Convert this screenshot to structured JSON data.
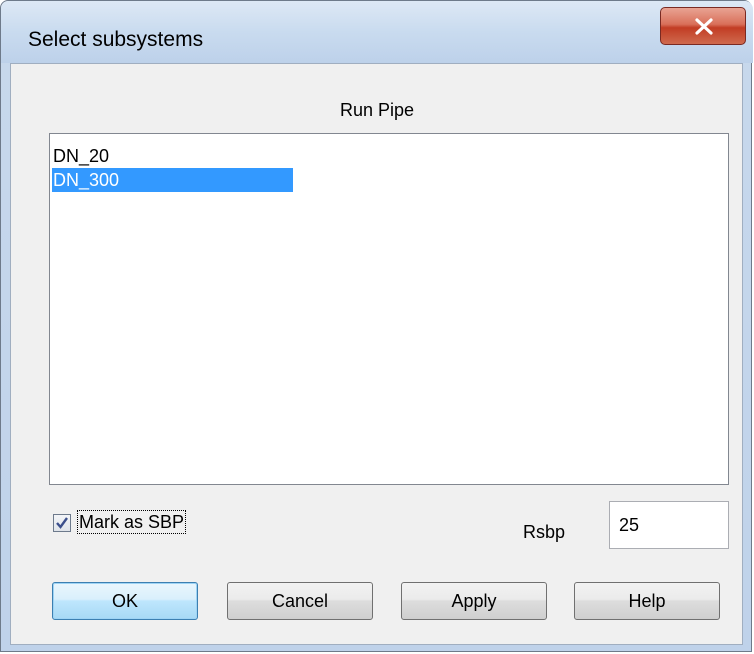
{
  "window": {
    "title": "Select subsystems",
    "close_icon": "close-icon"
  },
  "list": {
    "caption": "Run Pipe",
    "items": [
      {
        "label": "DN_20",
        "selected": false
      },
      {
        "label": "DN_300",
        "selected": true
      }
    ]
  },
  "options": {
    "mark_as_sbp_label": "Mark as SBP",
    "mark_as_sbp_checked": true,
    "rsbp_label": "Rsbp",
    "rsbp_value": "25"
  },
  "buttons": {
    "ok": "OK",
    "cancel": "Cancel",
    "apply": "Apply",
    "help": "Help"
  },
  "colors": {
    "selection": "#3399ff",
    "close_button": "#c23d24"
  }
}
